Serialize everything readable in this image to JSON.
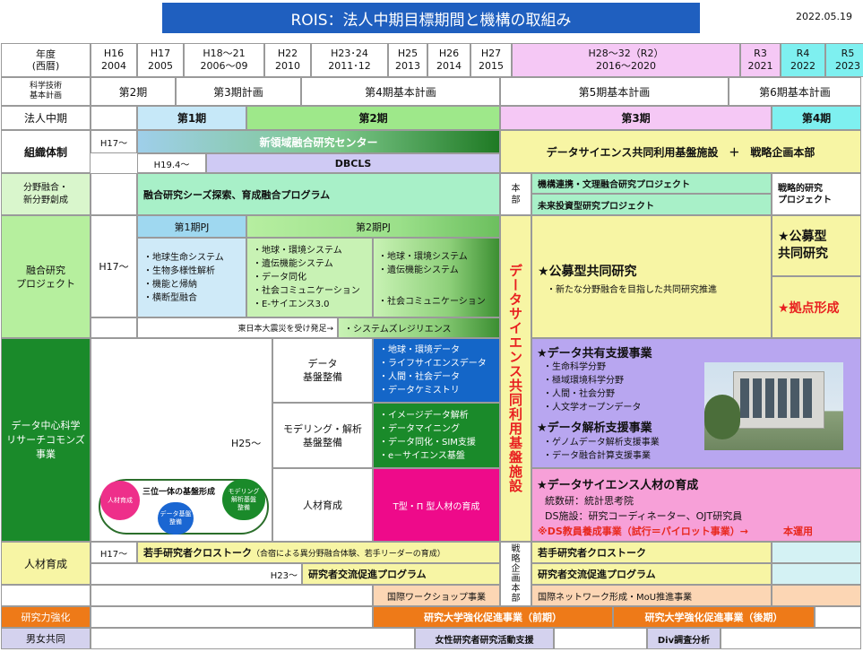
{
  "title": "ROIS：法人中期目標期間と機構の取組み",
  "date": "2022.05.19",
  "header": {
    "year_label": "年度\n(西暦)",
    "years": [
      {
        "h": "H16",
        "w": "2004"
      },
      {
        "h": "H17",
        "w": "2005"
      },
      {
        "h": "H18～21",
        "w": "2006～09"
      },
      {
        "h": "H22",
        "w": "2010"
      },
      {
        "h": "H23･24",
        "w": "2011･12"
      },
      {
        "h": "H25",
        "w": "2013"
      },
      {
        "h": "H26",
        "w": "2014"
      },
      {
        "h": "H27",
        "w": "2015"
      },
      {
        "h": "H28～32（R2）",
        "w": "2016～2020"
      },
      {
        "h": "R3",
        "w": "2021"
      },
      {
        "h": "R4",
        "w": "2022"
      },
      {
        "h": "R5",
        "w": "2023"
      }
    ]
  },
  "plan": {
    "label": "科学技術\n基本計画",
    "p2": "第2期",
    "p3": "第3期計画",
    "p4": "第4期基本計画",
    "p5": "第5期基本計画",
    "p6": "第6期基本計画"
  },
  "periods": {
    "label": "法人中期",
    "p1": "第1期",
    "p2": "第2期",
    "p3": "第3期",
    "p4": "第4期"
  },
  "org": {
    "label": "組織体制",
    "h17": "H17～",
    "center": "新領域融合研究センター",
    "h19": "H19.4～",
    "dbcls": "DBCLS",
    "ds_facility": "データサイエンス共同利用基盤施設　＋　戦略企画本部"
  },
  "fusion": {
    "label": "分野融合・\n新分野創成",
    "program": "融合研究シーズ探索、育成融合プログラム",
    "honbu": "本\n部",
    "p1": "機構連携・文理融合研究プロジェクト",
    "p2": "未来投資型研究プロジェクト",
    "strategic": "戦略的研究\nプロジェクト"
  },
  "project": {
    "label": "融合研究\nプロジェクト",
    "h17": "H17～",
    "pj1": "第1期PJ",
    "pj2": "第2期PJ",
    "list1": [
      "・地球生命システム",
      "・生物多様性解析",
      "・機能と帰納",
      "・横断型融合"
    ],
    "list2": [
      "・地球・環境システム",
      "・遺伝機能システム",
      "・データ同化",
      "・社会コミュニケーション",
      "・E-サイエンス3.0"
    ],
    "list3a": [
      "・地球・環境システム",
      "・遺伝機能システム"
    ],
    "list3b": "・社会コミュニケーション",
    "quake": "東日本大震災を受け発足→",
    "resilience": "・システムズレジリエンス",
    "vertical": "データサイエンス共同利用基盤施設",
    "koubo": "★公募型共同研究",
    "koubo_sub": "・新たな分野融合を目指した共同研究推進",
    "koubo2": "★公募型\n共同研究",
    "kyoten": "★拠点形成"
  },
  "dscenter": {
    "label": "データ中心科学\nリサーチコモンズ\n事業",
    "h25": "H25～",
    "trinity": {
      "title": "三位一体の基盤形成",
      "a": "人材育成",
      "b": "データ基盤\n整備",
      "c": "モデリング\n解析基盤\n整備"
    },
    "row1": "データ\n基盤整備",
    "row2": "モデリング・解析\n基盤整備",
    "row3": "人材育成",
    "blue": [
      "・地球・環境データ",
      "・ライフサイエンスデータ",
      "・人間・社会データ",
      "・データケミストリ"
    ],
    "green": [
      "・イメージデータ解析",
      "・データマイニング",
      "・データ同化・SIM支援",
      "・e－サイエンス基盤"
    ],
    "pink": "T型・Π 型人材の育成",
    "share_title": "★データ共有支援事業",
    "share": [
      "・生命科学分野",
      "・極域環境科学分野",
      "・人間・社会分野",
      "・人文学オープンデータ"
    ],
    "anal_title": "★データ解析支援事業",
    "anal": [
      "・ゲノムデータ解析支援事業",
      "・データ融合計算支援事業"
    ],
    "hr_title": "★データサイエンス人材の育成",
    "hr1": "統数研：統計思考院",
    "hr2": "DS施設：研究コーディネーター、OJT研究員",
    "hr3": "※DS教員養成事業（試行＝パイロット事業）→",
    "hr3b": "本運用"
  },
  "human": {
    "label": "人材育成",
    "h17": "H17～",
    "cross": "若手研究者クロストーク",
    "cross_note": "（合宿による異分野融合体験、若手リーダーの育成）",
    "h23": "H23～",
    "exchange": "研究者交流促進プログラム",
    "senryaku": "戦\n略\n企\n画\n本\n部",
    "cross2": "若手研究者クロストーク",
    "exchange2": "研究者交流促進プログラム",
    "workshop": "国際ワークショップ事業",
    "network": "国際ネットワーク形成・MoU推進事業"
  },
  "research": {
    "label": "研究力強化",
    "early": "研究大学強化促進事業（前期）",
    "late": "研究大学強化促進事業（後期）"
  },
  "gender": {
    "label": "男女共同",
    "support": "女性研究者研究活動支援",
    "div": "Div調査分析"
  },
  "colors": {
    "title_bg": "#1f5fbf",
    "p1": "#c6e8f8",
    "p2": "#9ee88a",
    "p3": "#f5c8f5",
    "p4": "#7ef0f0",
    "ds_red": "#ee2020",
    "purple": "#b8a6f0",
    "magenta": "#ee0a8a",
    "orange": "#ee7a18"
  }
}
